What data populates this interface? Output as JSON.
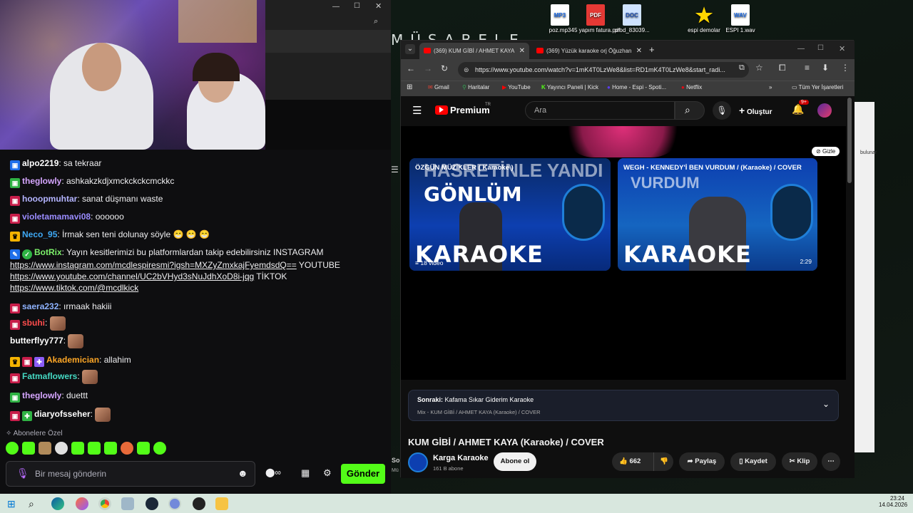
{
  "desktop": {
    "banner_text": "MÜSABELE",
    "icons": [
      {
        "label": "poz.mp3",
        "type": "MP3"
      },
      {
        "label": "45 yapım fatura.pdf",
        "type": "PDF"
      },
      {
        "label": "prod_83039...",
        "type": "DOC"
      },
      {
        "label": "espi demolar",
        "type": "STAR"
      },
      {
        "label": "ESPI 1.wav",
        "type": "WAV"
      }
    ]
  },
  "chat": {
    "messages": [
      {
        "user": "alpo2219",
        "text": ": sa tekraar",
        "color": "#ffffff"
      },
      {
        "user": "theglowly",
        "text": ": ashkakzkdjxmckckckcmckkc",
        "color": "#d6a6ff"
      },
      {
        "user": "hooopmuhtar",
        "text": ": sanat düşmanı waste",
        "color": "#b4b4ff"
      },
      {
        "user": "violetamamavi08",
        "text": ": oooooo",
        "color": "#9a8cff"
      },
      {
        "user": "Neco_95",
        "text": ": İrmak sen teni dolunay söyle 😁 😁 😁",
        "color": "#3fa9f5"
      },
      {
        "user": "BotRix",
        "text": ": Yayın kesitlerimizi bu platformlardan takip edebilirsiniz INSTAGRAM",
        "color": "#7cf06a"
      },
      {
        "user": "saera232",
        "text": ": ırmaak hakiii",
        "color": "#8fb3ff"
      },
      {
        "user": "sbuhi",
        "text": ":",
        "color": "#ff4d4d"
      },
      {
        "user": "butterflyy777",
        "text": ":",
        "color": "#ffffff"
      },
      {
        "user": "Akademician",
        "text": ": allahim",
        "color": "#ffa726"
      },
      {
        "user": "Fatmaflowers",
        "text": ":",
        "color": "#45d9c3"
      },
      {
        "user": "theglowly",
        "text": ": duettt",
        "color": "#d6a6ff"
      },
      {
        "user": "diaryofsseher",
        "text": ":",
        "color": "#ffffff"
      }
    ],
    "botrix_links": [
      "https://www.instagram.com/mcdlespiresmi?igsh=MXZyZmxkajFyemdsdQ==",
      " YOUTUBE",
      "https://www.youtube.com/channel/UC2bVHyd3sNuJdhXoD8i-jqg",
      " TİKTOK",
      "https://www.tiktok.com/@mcdlkick"
    ],
    "emote_menu_label": "Abonelere Özel",
    "input_placeholder": "Bir mesaj gönderin",
    "send_label": "Gönder"
  },
  "browser": {
    "tabs": [
      {
        "title": "(369) KUM GİBİ / AHMET KAYA"
      },
      {
        "title": "(369) Yüzük karaoke orj Öğuzhan"
      }
    ],
    "url": "https://www.youtube.com/watch?v=1mK4T0LzWe8&list=RD1mK4T0LzWe8&start_radi...",
    "bookmarks": [
      "Gmail",
      "Haritalar",
      "YouTube",
      "Yayıncı Paneli | Kick",
      "Home - Espi - Spoti...",
      "Netflix"
    ],
    "all_bookmarks": "Tüm Yer İşaretleri"
  },
  "youtube": {
    "logo_text": "Premium",
    "logo_sup": "TR",
    "search_placeholder": "Ara",
    "create_label": "Oluştur",
    "notif_count": "9+",
    "hide_label": "Gizle",
    "cards": [
      {
        "title": "ÖZGÜN MÜZİKLER ( Karaoke )",
        "art_top": "HASRETİNLE YANDI",
        "art_mid": "GÖNLÜM",
        "art_bottom": "KARAOKE",
        "meta": "18 video"
      },
      {
        "title": "WEGH - KENNEDY'İ BEN VURDUM / (Karaoke) / COVER",
        "art_top": "VURDUM",
        "art_bottom": "KARAOKE",
        "meta": "2:29"
      }
    ],
    "up_next_label": "Sonraki:",
    "up_next_title": "Kafama Sıkar Giderim Karaoke",
    "up_next_sub": "Mix - KUM GİBİ / AHMET KAYA (Karaoke) / COVER",
    "video_title": "KUM GİBİ / AHMET KAYA (Karaoke) / COVER",
    "channel": "Karga Karaoke",
    "subs": "161 B abone",
    "subscribe": "Abone ol",
    "likes": "662",
    "share": "Paylaş",
    "save": "Kaydet",
    "clip": "Klip"
  },
  "side_text": {
    "bulunan": "bulunar",
    "so": "So",
    "mu": "Mü"
  },
  "taskbar": {
    "time": "23:24",
    "date": "14.04.2026"
  }
}
